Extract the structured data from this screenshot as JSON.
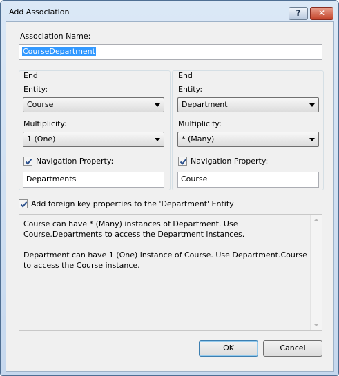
{
  "window": {
    "title": "Add Association",
    "help_label": "?",
    "close_label": "✕"
  },
  "association_name": {
    "label": "Association Name:",
    "value": "CourseDepartment"
  },
  "ends": [
    {
      "group_label": "End",
      "entity_label": "Entity:",
      "entity_value": "Course",
      "multiplicity_label": "Multiplicity:",
      "multiplicity_value": "1 (One)",
      "nav_checked": true,
      "nav_label": "Navigation Property:",
      "nav_value": "Departments"
    },
    {
      "group_label": "End",
      "entity_label": "Entity:",
      "entity_value": "Department",
      "multiplicity_label": "Multiplicity:",
      "multiplicity_value": "* (Many)",
      "nav_checked": true,
      "nav_label": "Navigation Property:",
      "nav_value": "Course"
    }
  ],
  "foreign_key": {
    "checked": true,
    "label": "Add foreign key properties to the 'Department' Entity"
  },
  "description": {
    "paragraph1": "Course can have * (Many) instances of Department. Use Course.Departments to access the Department instances.",
    "paragraph2": "Department can have 1 (One) instance of Course. Use Department.Course to access the Course instance."
  },
  "buttons": {
    "ok": "OK",
    "cancel": "Cancel"
  }
}
